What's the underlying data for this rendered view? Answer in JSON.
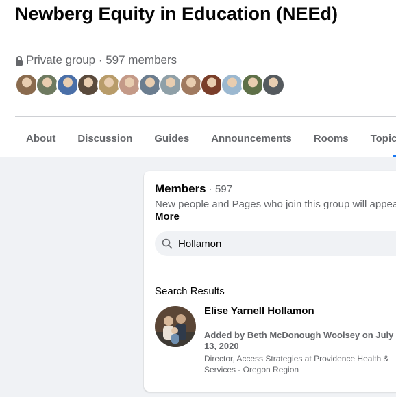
{
  "group": {
    "title": "Newberg Equity in Education (NEEd)",
    "meta": "Private group · 597 members",
    "member_avatars": [
      {
        "name": "member-avatar",
        "color": "#8a6b4e"
      },
      {
        "name": "member-avatar",
        "color": "#6e7a60"
      },
      {
        "name": "member-avatar",
        "color": "#4a6fa8"
      },
      {
        "name": "member-avatar",
        "color": "#5a4a3c"
      },
      {
        "name": "member-avatar",
        "color": "#b89c6a"
      },
      {
        "name": "member-avatar",
        "color": "#c49a88"
      },
      {
        "name": "member-avatar",
        "color": "#6b7d8f"
      },
      {
        "name": "member-avatar",
        "color": "#8fa0a8"
      },
      {
        "name": "member-avatar",
        "color": "#a07a60"
      },
      {
        "name": "member-avatar",
        "color": "#7a3e2a"
      },
      {
        "name": "member-avatar",
        "color": "#9bb8d0"
      },
      {
        "name": "member-avatar",
        "color": "#5e7048"
      },
      {
        "name": "member-avatar",
        "color": "#555a5e"
      }
    ]
  },
  "tabs": [
    "About",
    "Discussion",
    "Guides",
    "Announcements",
    "Rooms",
    "Topics"
  ],
  "members": {
    "heading": "Members",
    "count": " · 597",
    "description": "New people and Pages who join this group will appear here.",
    "more_label": "More",
    "search_value": "Hollamon",
    "results_heading": "Search Results",
    "result": {
      "name": "Elise Yarnell Hollamon",
      "added": "Added by Beth McDonough Woolsey on July 13, 2020",
      "job": "Director, Access Strategies at Providence Health & Services - Oregon Region"
    }
  },
  "colors": {
    "accent": "#1877f2",
    "background": "#f0f2f5",
    "secondary_text": "#65676b"
  }
}
